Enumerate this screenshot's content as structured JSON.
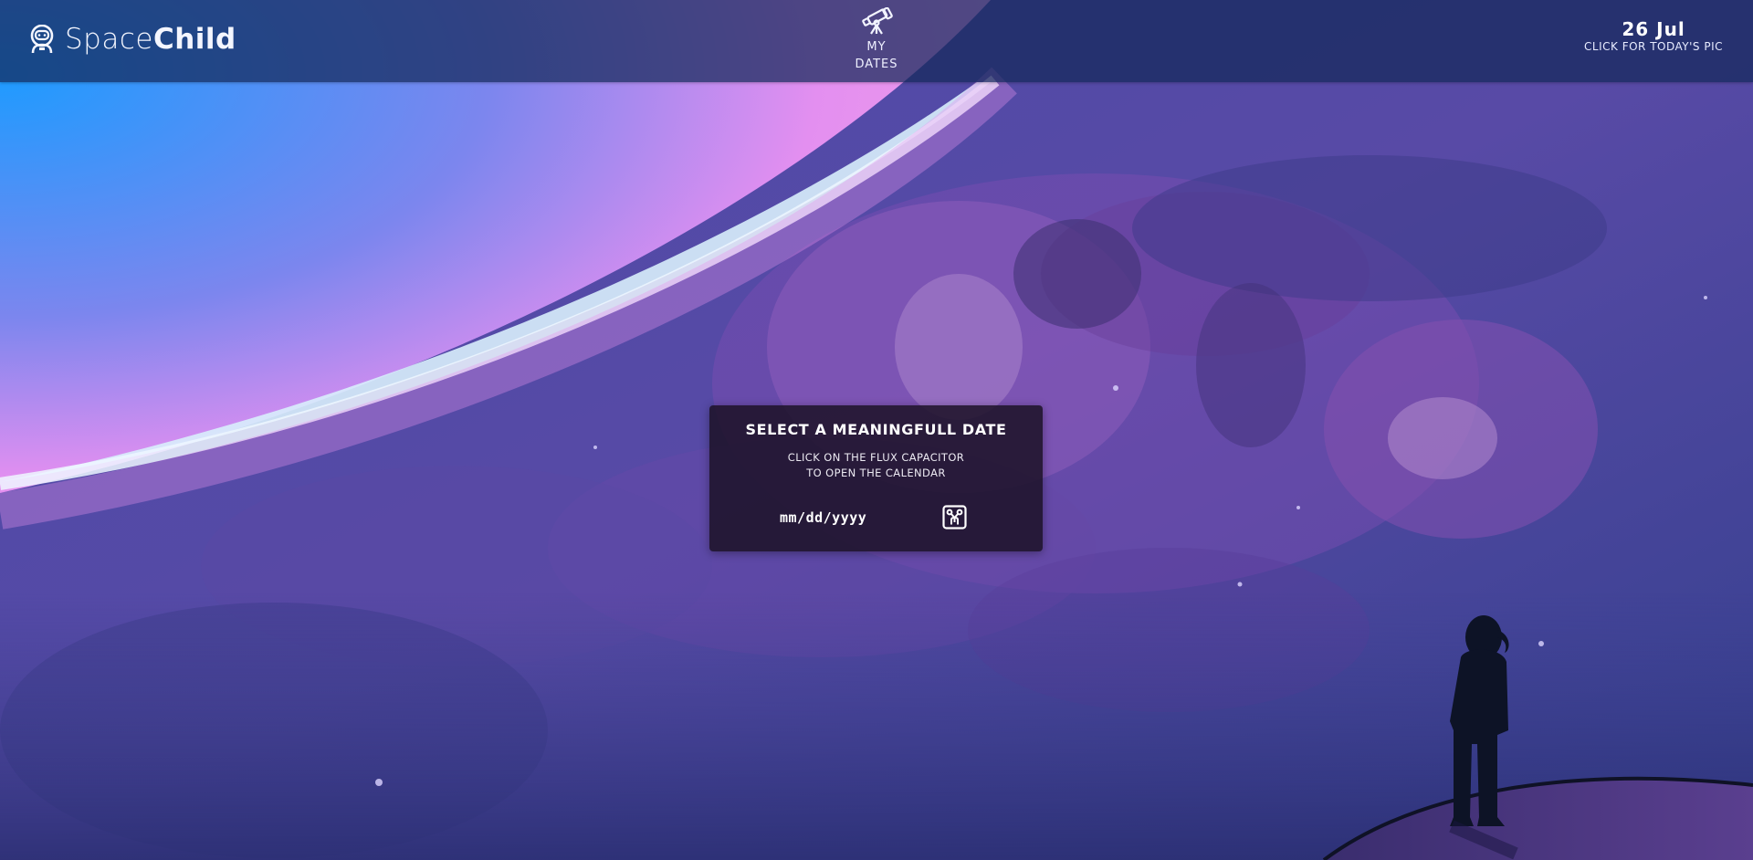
{
  "navbar": {
    "brand": {
      "name_light": "Space",
      "name_bold": "Child",
      "logo_icon": "astronaut-icon"
    },
    "my_dates": {
      "icon": "telescope-icon",
      "line1": "MY",
      "line2": "DATES"
    },
    "today": {
      "date": "26 Jul",
      "caption": "CLICK FOR TODAY'S PIC"
    }
  },
  "dialog": {
    "title": "SELECT A MEANINGFULL DATE",
    "instruction_line1": "CLICK ON THE FLUX CAPACITOR",
    "instruction_line2": "TO OPEN THE CALENDAR",
    "date_input": {
      "value": "",
      "placeholder": "mm/dd/yyyy"
    },
    "calendar_button_icon": "flux-capacitor-icon"
  },
  "colors": {
    "navbar": "#1b3166",
    "accent_pink": "#e28cf0",
    "accent_blue": "#2a98ff",
    "dialog_bg": "#1c1226",
    "silhouette": "#0d1326"
  }
}
